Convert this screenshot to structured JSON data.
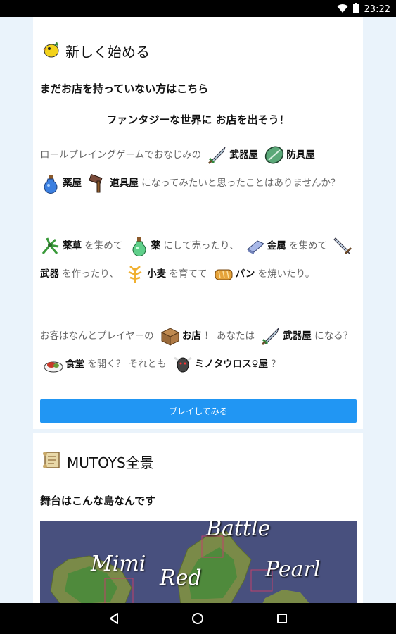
{
  "status": {
    "time": "23:22",
    "wifi_icon": "wifi-icon",
    "battery_icon": "battery-icon"
  },
  "new_start": {
    "heading": "新しく始める",
    "subheading": "まだお店を持っていない方はこちら",
    "tagline": "ファンタジーな世界に お店を出そう！",
    "p1": {
      "t1": "ロールプレイングゲームでおなじみの",
      "k1": "武器屋",
      "k2": "防具屋",
      "k3": "薬屋",
      "k4": "道具屋",
      "t2": "になってみたいと思ったことはありませんか？"
    },
    "p2": {
      "k1": "薬草",
      "t1": "を集めて",
      "k2": "薬",
      "t2": "にして売ったり、",
      "k3": "金属",
      "t3": "を集めて",
      "k4": "武器",
      "t4": "を作ったり、",
      "k5": "小麦",
      "t5": "を育てて",
      "k6": "パン",
      "t6": "を焼いたり。"
    },
    "p3": {
      "t1": "お客はなんとプレイヤーの",
      "k1": "お店",
      "t2": "！ あなたは",
      "k2": "武器屋",
      "t3": "になる？",
      "k3": "食堂",
      "t4": "を開く？ それとも",
      "k4": "ミノタウロス♀屋",
      "t5": "？"
    },
    "button": "プレイしてみる"
  },
  "overview": {
    "heading": "MUTOYS全景",
    "subheading": "舞台はこんな島なんです",
    "map_labels": {
      "battle": "Battle",
      "mimi": "Mimi",
      "red": "Red",
      "pearl": "Pearl"
    }
  },
  "colors": {
    "accent": "#2196f3",
    "background": "#eaf3fb"
  }
}
